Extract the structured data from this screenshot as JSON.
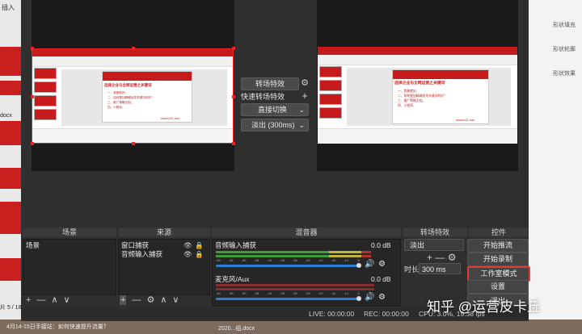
{
  "desktop": {
    "left_top_label": "插入",
    "left_bottom_label": "片 5 / 18",
    "left_bottom_label2": "docx",
    "bottom_file_text": "4月14-15日手接站：如何快速提升流量？",
    "bottom_file_text2": "2020...组.docx",
    "right_labels": [
      "形状填充",
      "形状轮廓",
      "形状效果"
    ]
  },
  "preview_slide": {
    "headline": "选择企业与全网运营之关键词",
    "bullets": [
      "一、我做就好。",
      "二、如何更加精确找寻关键词利好？",
      "三、推广策略文档。",
      "四、小程序。"
    ],
    "footer": "www.tci21.com"
  },
  "program_slide": {
    "headline": "选择企业与全网运营之关键词",
    "bullets": [
      "一、我做就好。",
      "二、如何更加精确找寻关键词利好？",
      "三、推广策略文档。",
      "四、小程序。"
    ],
    "footer": "www.tci21.com"
  },
  "transitions_center": {
    "transition_button": "转场特效",
    "quick_transitions_label": "快速转场特效",
    "direct_cut": "直接切换",
    "fade_duration": "淡出 (300ms)"
  },
  "docks": {
    "scenes": {
      "title": "场景",
      "items": [
        "场景"
      ]
    },
    "sources": {
      "title": "来源",
      "items": [
        "窗口捕获",
        "音频输入捕获"
      ]
    },
    "mixer": {
      "title": "混音器",
      "channels": [
        {
          "name": "音频输入捕获",
          "db": "0.0 dB"
        },
        {
          "name": "麦克风/Aux",
          "db": "0.0 dB"
        }
      ],
      "scale": [
        "-60",
        "-55",
        "-50",
        "-45",
        "-40",
        "-35",
        "-30",
        "-25",
        "-20",
        "-15",
        "-10",
        "-5",
        "0"
      ]
    },
    "transitions": {
      "title": "转场特效",
      "selected": "淡出",
      "duration_label": "时长",
      "duration_value": "300 ms"
    },
    "controls": {
      "title": "控件",
      "buttons": [
        "开始推流",
        "开始录制",
        "工作室模式",
        "设置",
        "退出"
      ]
    }
  },
  "statusbar": {
    "live": "LIVE: 00:00:00",
    "rec": "REC: 00:00:00",
    "cpu": "CPU: 3.0%, 19.38 fps"
  },
  "watermark": "知乎 @运营皮卡丘",
  "colors": {
    "accent_red": "#d42b2b",
    "panel": "#2f2f2f",
    "fader_blue": "#2a7fd4",
    "meter_green": "#3c9c3c"
  }
}
